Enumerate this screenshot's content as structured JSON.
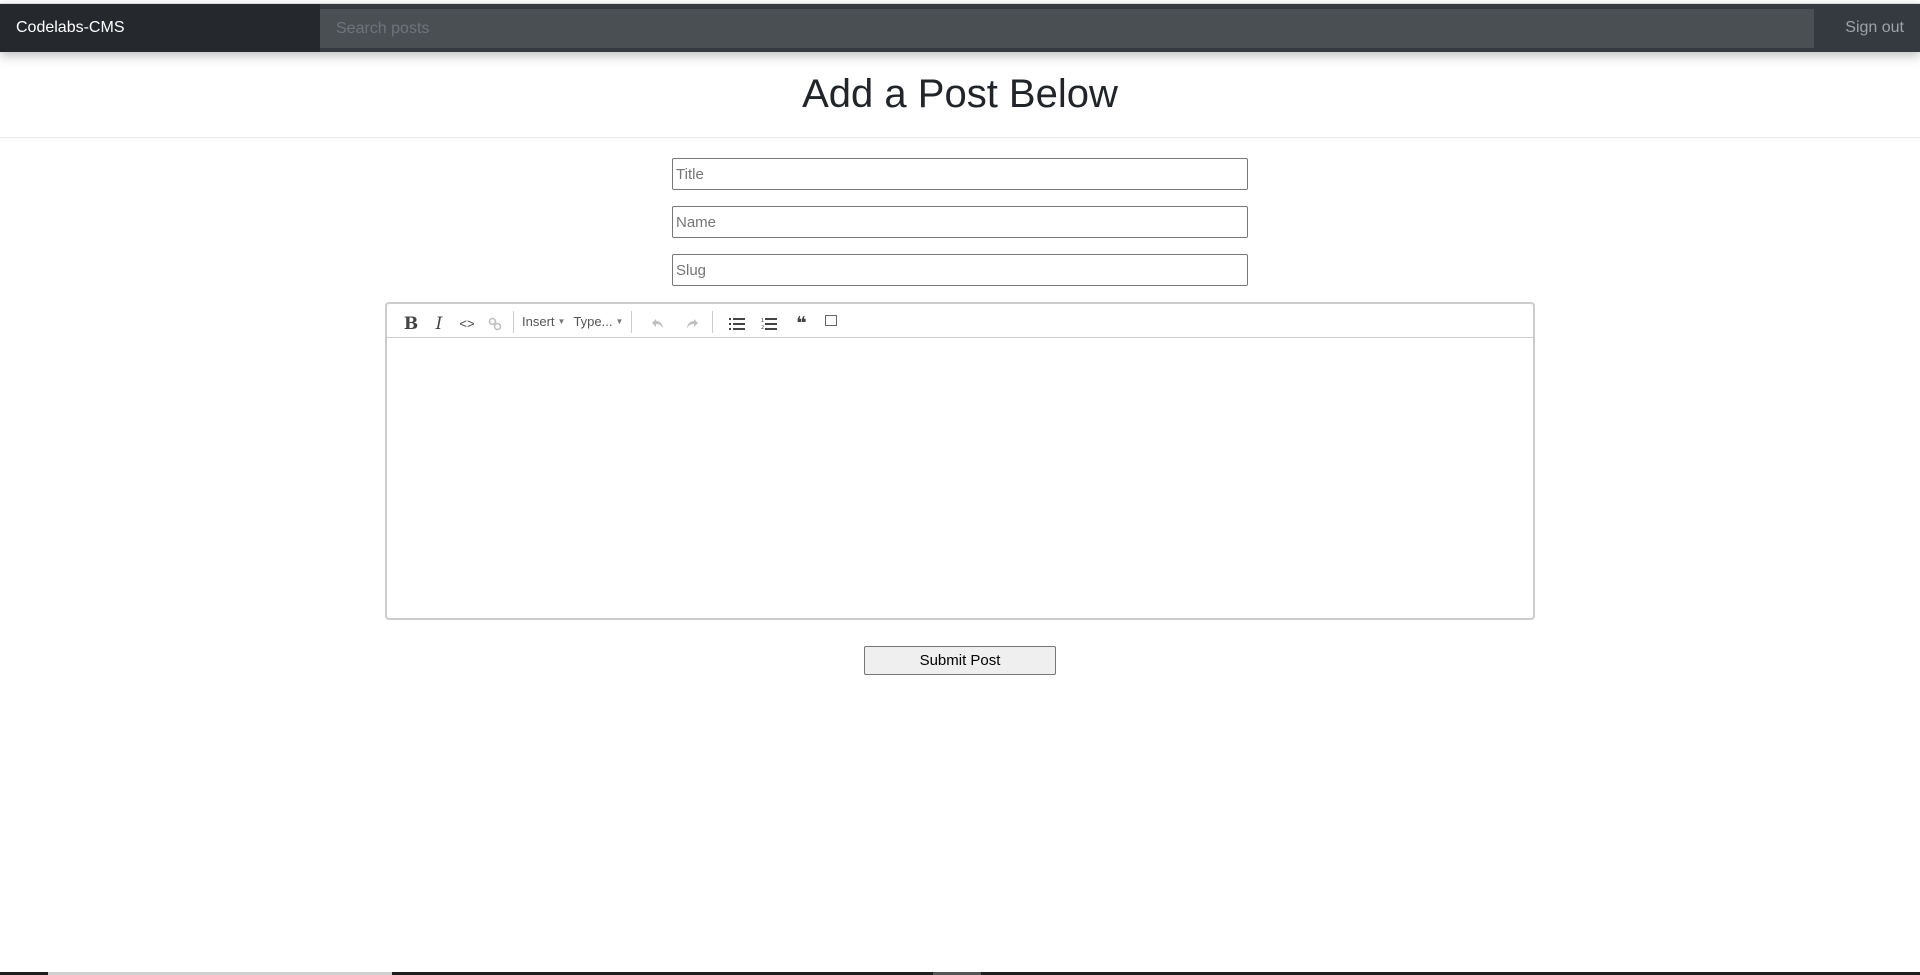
{
  "navbar": {
    "brand": "Codelabs-CMS",
    "search_placeholder": "Search posts",
    "signout_label": "Sign out"
  },
  "page": {
    "title": "Add a Post Below"
  },
  "form": {
    "title_placeholder": "Title",
    "title_value": "",
    "name_placeholder": "Name",
    "name_value": "",
    "slug_placeholder": "Slug",
    "slug_value": "",
    "submit_label": "Submit Post"
  },
  "editor": {
    "toolbar": {
      "bold": "B",
      "italic": "I",
      "code": "<>",
      "link": "🔗",
      "insert_label": "Insert",
      "type_label": "Type...",
      "undo": "↶",
      "redo": "↷",
      "bullet_list": "☰",
      "ordered_list": "☰",
      "blockquote": "❝",
      "caret": "▼"
    },
    "content": ""
  }
}
